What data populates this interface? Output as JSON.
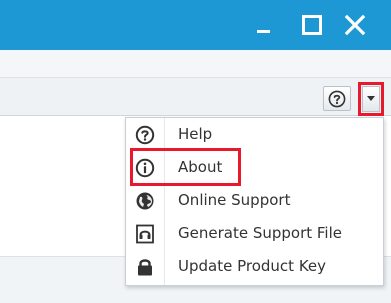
{
  "window_controls": {
    "minimize_icon": "minimize-icon",
    "maximize_icon": "maximize-icon",
    "close_icon": "close-icon"
  },
  "toolbar": {
    "help_button_icon": "help-circle-icon",
    "dropdown_icon": "caret-down-icon"
  },
  "help_menu": {
    "items": [
      {
        "label": "Help",
        "icon": "help-circle-icon"
      },
      {
        "label": "About",
        "icon": "info-circle-icon"
      },
      {
        "label": "Online Support",
        "icon": "globe-icon"
      },
      {
        "label": "Generate Support File",
        "icon": "headset-icon"
      },
      {
        "label": "Update Product Key",
        "icon": "lock-icon"
      }
    ]
  },
  "colors": {
    "titlebar": "#1e98d4",
    "highlight": "#e8192c",
    "icon": "#333333"
  }
}
